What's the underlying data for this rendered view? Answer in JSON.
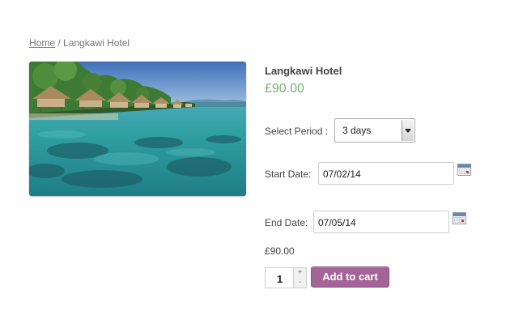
{
  "breadcrumb": {
    "home": "Home",
    "separator": " / ",
    "current": "Langkawi Hotel"
  },
  "product": {
    "title": "Langkawi Hotel",
    "price": "£90.00",
    "image_icon": "resort-photo"
  },
  "form": {
    "period_label": "Select Period :",
    "period_value": "3 days",
    "start_label": "Start Date:",
    "start_value": "07/02/14",
    "end_label": "End Date:",
    "end_value": "07/05/14",
    "calendar_icon": "calendar-icon",
    "total": "£90.00",
    "quantity": "1",
    "qty_up": "+",
    "qty_down": "-",
    "add_to_cart": "Add to cart"
  },
  "colors": {
    "price": "#7eb078",
    "button": "#a46497",
    "text": "#444444"
  }
}
